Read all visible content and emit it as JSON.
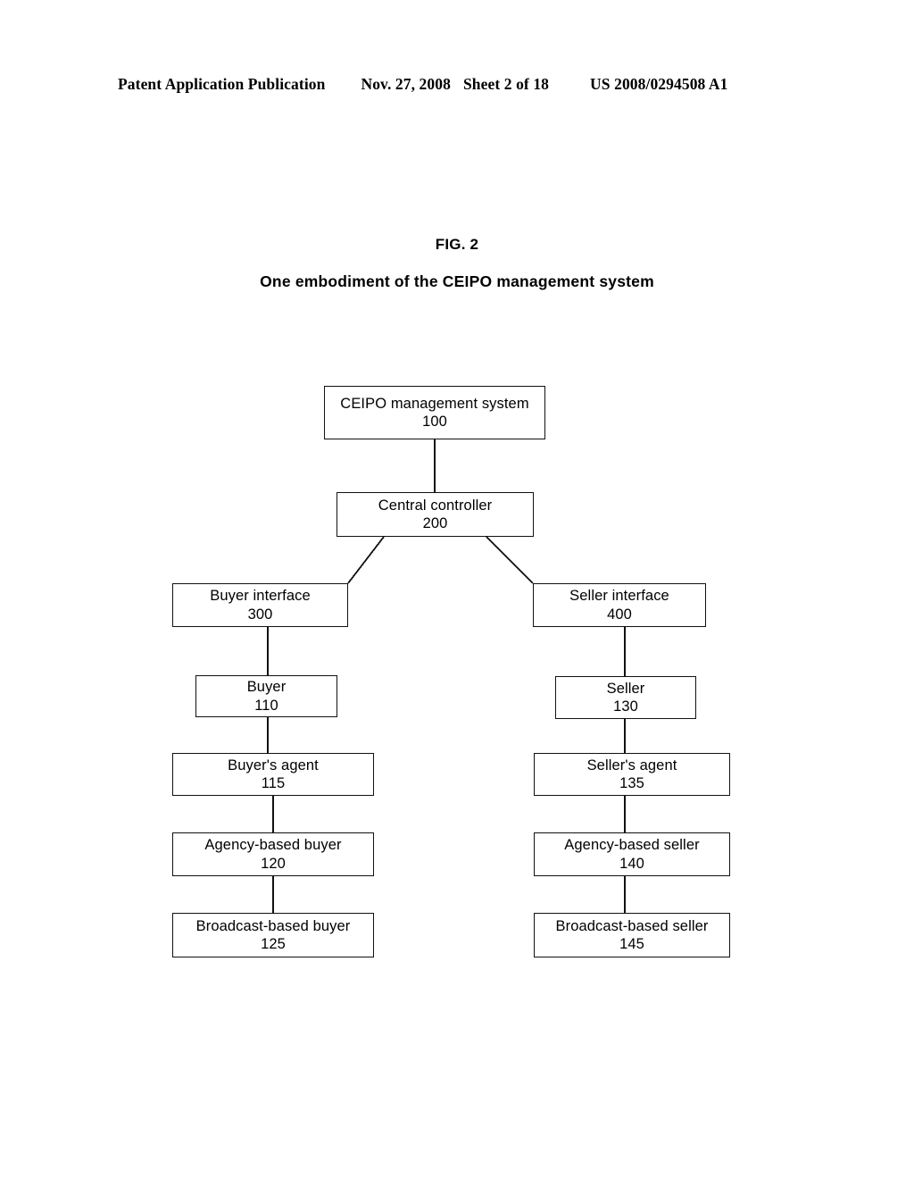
{
  "header": {
    "publication": "Patent Application Publication",
    "date": "Nov. 27, 2008",
    "sheet": "Sheet 2 of 18",
    "patent_number": "US 2008/0294508 A1"
  },
  "figure": {
    "label": "FIG. 2",
    "caption": "One embodiment of the CEIPO management system"
  },
  "diagram": {
    "nodes": {
      "ceipo": {
        "label": "CEIPO management system",
        "number": "100"
      },
      "central_controller": {
        "label": "Central controller",
        "number": "200"
      },
      "buyer_interface": {
        "label": "Buyer interface",
        "number": "300"
      },
      "seller_interface": {
        "label": "Seller interface",
        "number": "400"
      },
      "buyer": {
        "label": "Buyer",
        "number": "110"
      },
      "seller": {
        "label": "Seller",
        "number": "130"
      },
      "buyers_agent": {
        "label": "Buyer's agent",
        "number": "115"
      },
      "sellers_agent": {
        "label": "Seller's agent",
        "number": "135"
      },
      "agency_based_buyer": {
        "label": "Agency-based buyer",
        "number": "120"
      },
      "agency_based_seller": {
        "label": "Agency-based seller",
        "number": "140"
      },
      "broadcast_based_buyer": {
        "label": "Broadcast-based buyer",
        "number": "125"
      },
      "broadcast_based_seller": {
        "label": "Broadcast-based seller",
        "number": "145"
      }
    },
    "edges": [
      {
        "from": "ceipo",
        "to": "central_controller",
        "style": "vertical"
      },
      {
        "from": "central_controller",
        "to": "buyer_interface",
        "style": "diagonal"
      },
      {
        "from": "central_controller",
        "to": "seller_interface",
        "style": "diagonal"
      },
      {
        "from": "buyer_interface",
        "to": "buyer",
        "style": "vertical"
      },
      {
        "from": "buyer",
        "to": "buyers_agent",
        "style": "vertical"
      },
      {
        "from": "buyers_agent",
        "to": "agency_based_buyer",
        "style": "vertical"
      },
      {
        "from": "agency_based_buyer",
        "to": "broadcast_based_buyer",
        "style": "vertical"
      },
      {
        "from": "seller_interface",
        "to": "seller",
        "style": "vertical"
      },
      {
        "from": "seller",
        "to": "sellers_agent",
        "style": "vertical"
      },
      {
        "from": "sellers_agent",
        "to": "agency_based_seller",
        "style": "vertical"
      },
      {
        "from": "agency_based_seller",
        "to": "broadcast_based_seller",
        "style": "vertical"
      }
    ],
    "line_color": "#111111"
  }
}
